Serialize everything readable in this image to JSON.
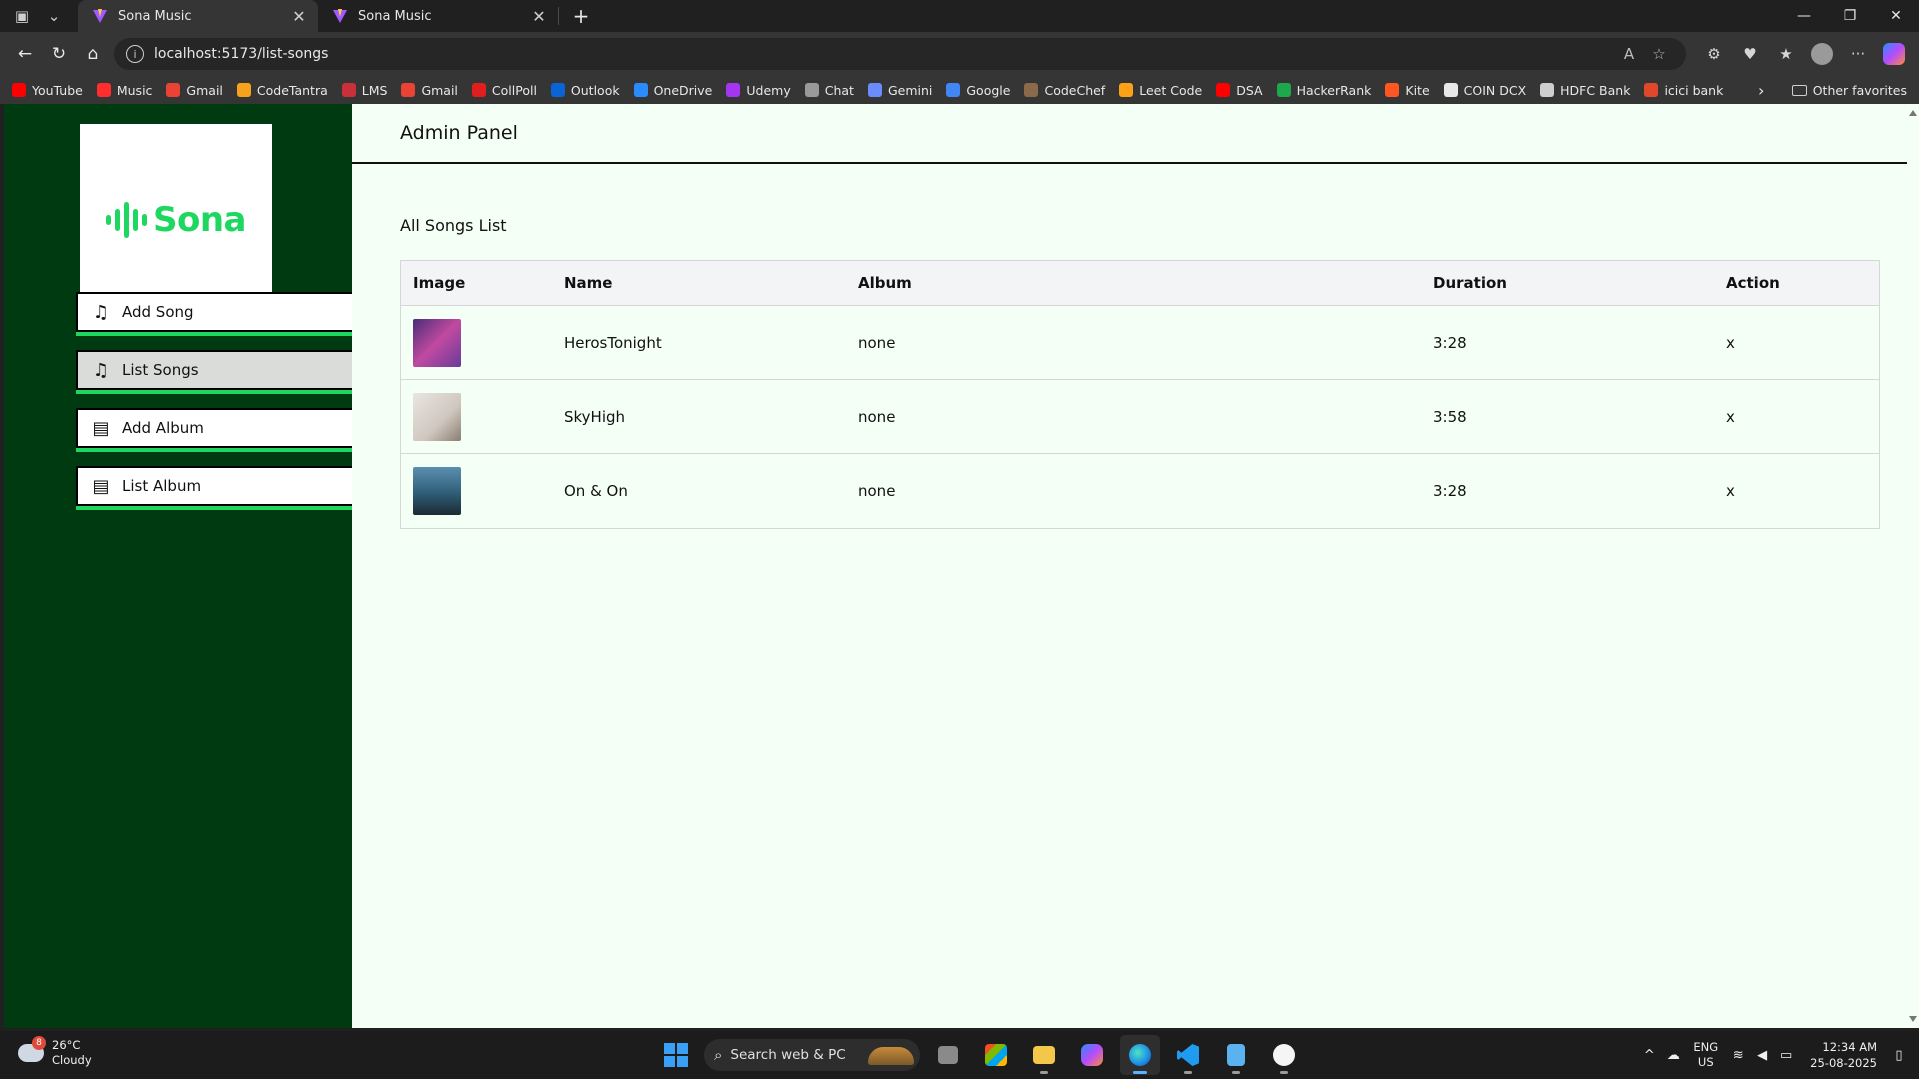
{
  "browser": {
    "tabs": [
      {
        "title": "Sona Music",
        "close": "✕",
        "active": true
      },
      {
        "title": "Sona Music",
        "close": "✕",
        "active": false
      }
    ],
    "new_tab": "+",
    "window_controls": {
      "minimize": "—",
      "restore": "❐",
      "close": "✕"
    },
    "url": "localhost:5173/list-songs",
    "nav": {
      "back": "←",
      "refresh": "↻",
      "home": "⌂"
    }
  },
  "favorites": {
    "items": [
      {
        "label": "YouTube",
        "color": "#ff0000"
      },
      {
        "label": "Music",
        "color": "#ff2d2d"
      },
      {
        "label": "Gmail",
        "color": "#ea4335"
      },
      {
        "label": "CodeTantra",
        "color": "#f7a21b"
      },
      {
        "label": "LMS",
        "color": "#c9303a"
      },
      {
        "label": "Gmail",
        "color": "#ea4335"
      },
      {
        "label": "CollPoll",
        "color": "#e01e1e"
      },
      {
        "label": "Outlook",
        "color": "#0a64d6"
      },
      {
        "label": "OneDrive",
        "color": "#2a8bff"
      },
      {
        "label": "Udemy",
        "color": "#a435f0"
      },
      {
        "label": "Chat",
        "color": "#9a9a9a"
      },
      {
        "label": "Gemini",
        "color": "#6a8cff"
      },
      {
        "label": "Google",
        "color": "#4285f4"
      },
      {
        "label": "CodeChef",
        "color": "#8a6a4a"
      },
      {
        "label": "Leet Code",
        "color": "#ffa116"
      },
      {
        "label": "DSA",
        "color": "#ff0000"
      },
      {
        "label": "HackerRank",
        "color": "#1ba94c"
      },
      {
        "label": "Kite",
        "color": "#ff5722"
      },
      {
        "label": "COIN DCX",
        "color": "#e8e8e8"
      },
      {
        "label": "HDFC Bank",
        "color": "#cfcfcf"
      },
      {
        "label": "icici bank",
        "color": "#e0472b"
      }
    ],
    "more": "›",
    "other": "Other favorites"
  },
  "app": {
    "logo_text": "Sona",
    "menu": [
      {
        "label": "Add Song",
        "icon": "♫"
      },
      {
        "label": "List Songs",
        "icon": "♫"
      },
      {
        "label": "Add Album",
        "icon": "▤"
      },
      {
        "label": "List Album",
        "icon": "▤"
      }
    ],
    "header_title": "Admin Panel",
    "section_title": "All Songs List",
    "table": {
      "columns": [
        "Image",
        "Name",
        "Album",
        "Duration",
        "Action"
      ],
      "rows": [
        {
          "name": "HerosTonight",
          "album": "none",
          "duration": "3:28",
          "action": "x"
        },
        {
          "name": "SkyHigh",
          "album": "none",
          "duration": "3:58",
          "action": "x"
        },
        {
          "name": "On & On",
          "album": "none",
          "duration": "3:28",
          "action": "x"
        }
      ]
    },
    "colors": {
      "sidebar": "#003a10",
      "accent": "#1ed760",
      "page_bg": "#f4fff6"
    }
  },
  "taskbar": {
    "weather": {
      "temp": "26°C",
      "condition": "Cloudy",
      "badge": "8"
    },
    "search_placeholder": "Search web & PC",
    "lang_top": "ENG",
    "lang_bottom": "US",
    "time": "12:34 AM",
    "date": "25-08-2025"
  }
}
